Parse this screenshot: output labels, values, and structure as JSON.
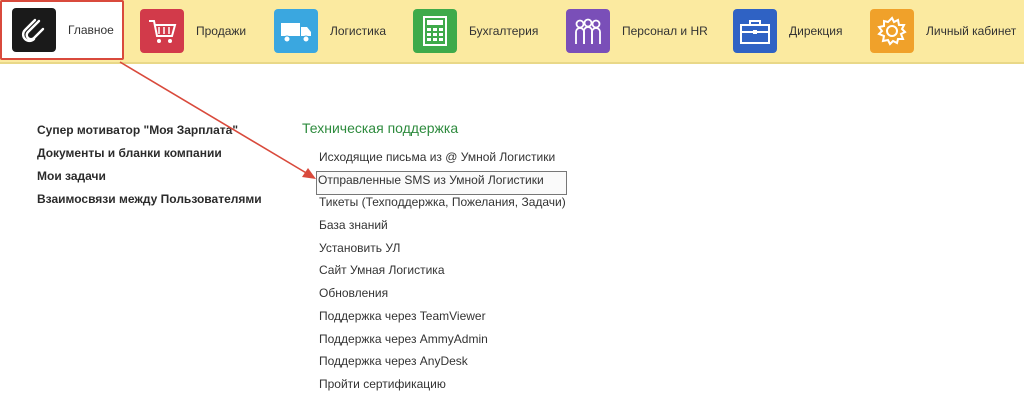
{
  "nav": {
    "tabs": [
      {
        "label": "Главное",
        "icon": "paperclip-icon",
        "color": "#1a1a1a",
        "active": true
      },
      {
        "label": "Продажи",
        "icon": "shopping-cart-icon",
        "color": "#d23a4a"
      },
      {
        "label": "Логистика",
        "icon": "truck-icon",
        "color": "#3aa7e0"
      },
      {
        "label": "Бухгалтерия",
        "icon": "calculator-icon",
        "color": "#3eaa4a"
      },
      {
        "label": "Персонал и HR",
        "icon": "people-icon",
        "color": "#7a4fb8"
      },
      {
        "label": "Дирекция",
        "icon": "briefcase-icon",
        "color": "#2f62c4"
      },
      {
        "label": "Личный кабинет",
        "icon": "gear-icon",
        "color": "#f0a12a"
      }
    ]
  },
  "left_links": [
    "Супер мотиватор \"Моя Зарплата\"",
    "Документы и бланки компании",
    "Мои задачи",
    "Взаимосвязи между Пользователями"
  ],
  "support": {
    "title": "Техническая поддержка",
    "links": [
      "Исходящие письма из @ Умной Логистики",
      "Отправленные SMS из Умной Логистики",
      "Тикеты (Техподдержка, Пожелания, Задачи)",
      "База знаний",
      "Установить УЛ",
      "Сайт Умная Логистика",
      "Обновления",
      "Поддержка через TeamViewer",
      "Поддержка через AmmyAdmin",
      "Поддержка через AnyDesk",
      "Пройти сертификацию"
    ],
    "selected_index": 1
  },
  "colors": {
    "accent_red": "#d94a3c",
    "section_green": "#2e8b3e",
    "topbar": "#fbeaa0"
  }
}
